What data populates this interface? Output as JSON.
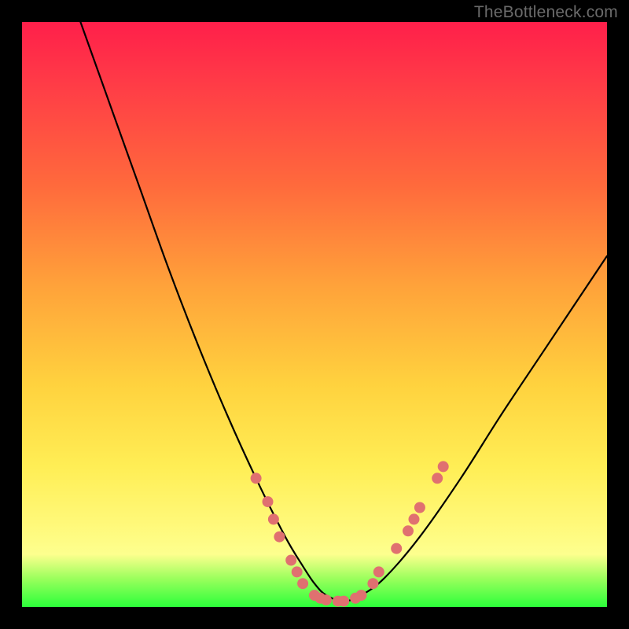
{
  "watermark": "TheBottleneck.com",
  "chart_data": {
    "type": "line",
    "title": "",
    "xlabel": "",
    "ylabel": "",
    "xlim": [
      0,
      100
    ],
    "ylim": [
      0,
      100
    ],
    "grid": false,
    "legend": false,
    "series": [
      {
        "name": "curve",
        "x": [
          10,
          15,
          20,
          25,
          30,
          35,
          40,
          45,
          48,
          50,
          52,
          55,
          58,
          62,
          68,
          75,
          82,
          90,
          100
        ],
        "y": [
          100,
          86,
          72,
          58,
          45,
          33,
          22,
          12,
          7,
          4,
          2,
          1,
          2,
          5,
          12,
          22,
          33,
          45,
          60
        ]
      }
    ],
    "markers": [
      {
        "x": 40,
        "y": 22
      },
      {
        "x": 42,
        "y": 18
      },
      {
        "x": 43,
        "y": 15
      },
      {
        "x": 44,
        "y": 12
      },
      {
        "x": 46,
        "y": 8
      },
      {
        "x": 47,
        "y": 6
      },
      {
        "x": 48,
        "y": 4
      },
      {
        "x": 50,
        "y": 2
      },
      {
        "x": 51,
        "y": 1.5
      },
      {
        "x": 52,
        "y": 1.2
      },
      {
        "x": 54,
        "y": 1
      },
      {
        "x": 55,
        "y": 1
      },
      {
        "x": 57,
        "y": 1.5
      },
      {
        "x": 58,
        "y": 2
      },
      {
        "x": 60,
        "y": 4
      },
      {
        "x": 61,
        "y": 6
      },
      {
        "x": 64,
        "y": 10
      },
      {
        "x": 66,
        "y": 13
      },
      {
        "x": 67,
        "y": 15
      },
      {
        "x": 68,
        "y": 17
      },
      {
        "x": 71,
        "y": 22
      },
      {
        "x": 72,
        "y": 24
      }
    ],
    "gradient_stops": [
      {
        "pos": 0,
        "color": "#ff1f4a"
      },
      {
        "pos": 28,
        "color": "#ff6a3c"
      },
      {
        "pos": 62,
        "color": "#ffd23e"
      },
      {
        "pos": 91,
        "color": "#fdff8e"
      },
      {
        "pos": 100,
        "color": "#2bff3a"
      }
    ]
  }
}
